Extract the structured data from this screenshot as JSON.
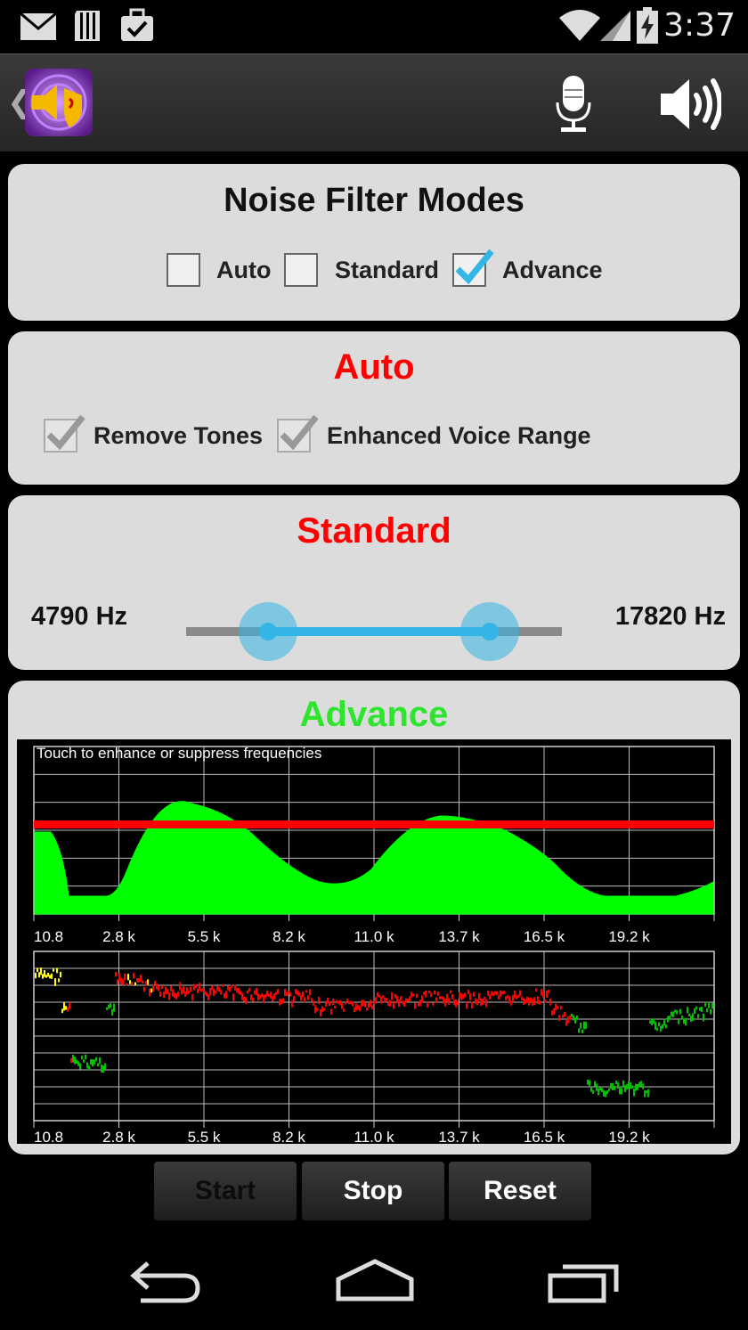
{
  "status_bar": {
    "time": "3:37",
    "icons": [
      "mail-icon",
      "sd-card-icon",
      "briefcase-check-icon",
      "wifi-icon",
      "signal-icon",
      "battery-charging-icon"
    ]
  },
  "action_bar": {
    "icons": [
      "back-caret-icon",
      "app-logo-icon",
      "microphone-icon",
      "speaker-icon"
    ]
  },
  "modes_panel": {
    "title": "Noise Filter Modes",
    "options": [
      {
        "label": "Auto",
        "checked": false
      },
      {
        "label": "Standard",
        "checked": false
      },
      {
        "label": "Advance",
        "checked": true
      }
    ]
  },
  "auto_panel": {
    "title": "Auto",
    "title_color": "#ff0000",
    "options": [
      {
        "label": "Remove Tones",
        "checked": true,
        "enabled": false
      },
      {
        "label": "Enhanced Voice Range",
        "checked": true,
        "enabled": false
      }
    ]
  },
  "standard_panel": {
    "title": "Standard",
    "title_color": "#ff0000",
    "low_label": "4790 Hz",
    "high_label": "17820 Hz",
    "range_min_hz": 0,
    "range_max_hz": 22050,
    "low_value_hz": 4790,
    "high_value_hz": 17820
  },
  "advance_panel": {
    "title": "Advance",
    "title_color": "#2ee52e",
    "hint": "Touch to enhance or suppress frequencies",
    "x_tick_labels": [
      "10.8",
      "2.8 k",
      "5.5 k",
      "8.2 k",
      "11.0 k",
      "13.7 k",
      "16.5 k",
      "19.2 k"
    ]
  },
  "buttons": {
    "start": "Start",
    "stop": "Stop",
    "reset": "Reset"
  },
  "nav_bar": {
    "icons": [
      "back-icon",
      "home-icon",
      "recent-apps-icon"
    ]
  },
  "colors": {
    "accent": "#33b5e5",
    "filter_fill": "#00ff00",
    "threshold_line": "#ff0000",
    "spectrum_high": "#ffff00",
    "spectrum_mid": "#ff0000",
    "spectrum_low": "#00c000"
  }
}
